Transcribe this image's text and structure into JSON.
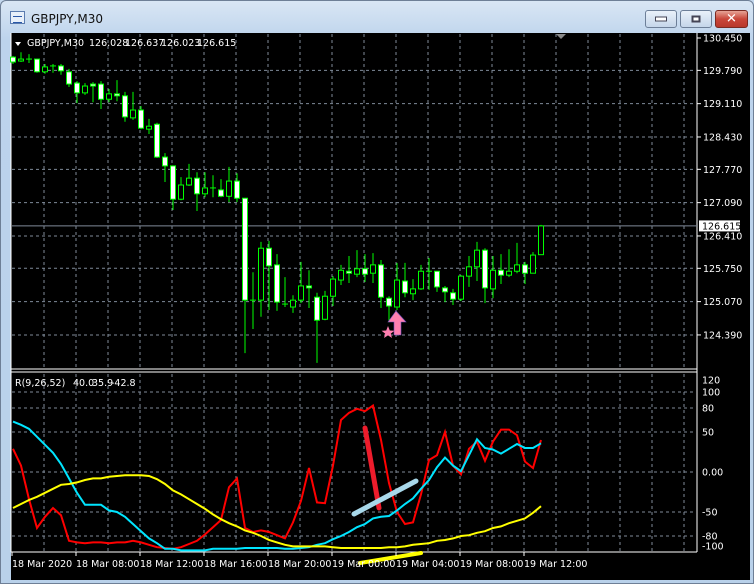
{
  "window": {
    "title": "GBPJPY,M30",
    "icon": "chart-window-icon",
    "buttons": [
      "minimize",
      "maximize",
      "close"
    ]
  },
  "colors": {
    "background": "#000000",
    "candle": "#00ff00",
    "bear_body": "#ffffff",
    "bull_body": "#000000",
    "grid": "#8090a0",
    "red_line": "#ff0000",
    "cyan_line": "#00e5ff",
    "yellow_line": "#ffff00",
    "arrow": "#ff7fb0"
  },
  "header": {
    "symbol": "GBPJPY,M30",
    "open": "126.028",
    "high": "126.637",
    "low": "126.023",
    "close": "126.615"
  },
  "price_axis": {
    "labels": [
      "130.450",
      "129.790",
      "129.110",
      "128.430",
      "127.770",
      "127.090",
      "126.410",
      "125.750",
      "125.070",
      "124.390"
    ],
    "current_price": "126.615"
  },
  "indicator": {
    "name": "R(9,26,52)",
    "values": [
      "40.0",
      "35.9",
      "-42.8"
    ],
    "levels": [
      "120",
      "100",
      "80",
      "50",
      "0.00",
      "-50",
      "-80",
      "-100"
    ]
  },
  "time_axis": {
    "labels": [
      "18 Mar 2020",
      "18 Mar 08:00",
      "18 Mar 12:00",
      "18 Mar 16:00",
      "18 Mar 20:00",
      "19 Mar 00:00",
      "19 Mar 04:00",
      "19 Mar 08:00",
      "19 Mar 12:00"
    ]
  },
  "chart_data": [
    {
      "type": "candlestick",
      "timeframe": "M30",
      "ylim": [
        123.72,
        130.55
      ],
      "grid": true,
      "ohlc": [
        [
          130.06,
          130.08,
          129.92,
          129.96
        ],
        [
          129.98,
          130.16,
          129.96,
          130.02
        ],
        [
          130.0,
          130.12,
          129.94,
          130.02
        ],
        [
          130.02,
          130.02,
          129.74,
          129.76
        ],
        [
          129.76,
          129.92,
          129.72,
          129.86
        ],
        [
          129.86,
          129.92,
          129.74,
          129.88
        ],
        [
          129.88,
          129.92,
          129.7,
          129.78
        ],
        [
          129.76,
          129.82,
          129.45,
          129.51
        ],
        [
          129.53,
          129.57,
          129.12,
          129.33
        ],
        [
          129.33,
          129.53,
          129.29,
          129.47
        ],
        [
          129.51,
          129.55,
          129.14,
          129.47
        ],
        [
          129.51,
          129.57,
          129.0,
          129.2
        ],
        [
          129.2,
          129.41,
          129.14,
          129.31
        ],
        [
          129.31,
          129.59,
          129.16,
          129.27
        ],
        [
          129.27,
          129.35,
          128.74,
          128.84
        ],
        [
          128.82,
          129.35,
          128.78,
          128.98
        ],
        [
          128.98,
          129.06,
          128.59,
          128.61
        ],
        [
          128.59,
          128.8,
          128.49,
          128.65
        ],
        [
          128.69,
          128.72,
          128.0,
          128.02
        ],
        [
          128.02,
          128.1,
          127.51,
          127.84
        ],
        [
          127.84,
          127.84,
          126.94,
          127.16
        ],
        [
          127.16,
          127.61,
          127.14,
          127.45
        ],
        [
          127.45,
          127.88,
          127.43,
          127.59
        ],
        [
          127.59,
          127.71,
          126.92,
          127.27
        ],
        [
          127.27,
          127.71,
          127.2,
          127.39
        ],
        [
          127.39,
          127.65,
          127.2,
          127.39
        ],
        [
          127.35,
          127.57,
          127.2,
          127.22
        ],
        [
          127.22,
          127.82,
          127.1,
          127.53
        ],
        [
          127.53,
          127.69,
          127.1,
          127.18
        ],
        [
          127.18,
          127.18,
          124.02,
          125.1
        ],
        [
          125.1,
          125.67,
          124.51,
          125.1
        ],
        [
          125.1,
          126.29,
          124.76,
          126.16
        ],
        [
          126.16,
          126.31,
          124.9,
          125.8
        ],
        [
          125.82,
          126.04,
          124.88,
          125.06
        ],
        [
          125.02,
          125.57,
          124.96,
          125.02
        ],
        [
          124.96,
          125.2,
          124.84,
          125.1
        ],
        [
          125.1,
          125.88,
          125.04,
          125.39
        ],
        [
          125.39,
          125.71,
          124.94,
          125.35
        ],
        [
          125.16,
          125.25,
          123.82,
          124.69
        ],
        [
          124.71,
          125.29,
          124.69,
          125.18
        ],
        [
          125.18,
          125.59,
          124.98,
          125.53
        ],
        [
          125.51,
          125.82,
          125.41,
          125.71
        ],
        [
          125.69,
          126.0,
          125.45,
          125.65
        ],
        [
          125.63,
          126.12,
          125.57,
          125.74
        ],
        [
          125.74,
          126.04,
          125.47,
          125.63
        ],
        [
          125.65,
          126.06,
          125.45,
          125.82
        ],
        [
          125.82,
          125.92,
          124.94,
          125.16
        ],
        [
          125.14,
          125.18,
          124.65,
          124.98
        ],
        [
          124.96,
          125.86,
          124.9,
          125.51
        ],
        [
          125.49,
          125.86,
          125.16,
          125.25
        ],
        [
          125.23,
          125.53,
          125.1,
          125.33
        ],
        [
          125.33,
          125.82,
          125.31,
          125.69
        ],
        [
          125.69,
          125.96,
          125.31,
          125.69
        ],
        [
          125.69,
          125.69,
          125.27,
          125.37
        ],
        [
          125.35,
          125.39,
          125.06,
          125.27
        ],
        [
          125.25,
          125.33,
          125.0,
          125.12
        ],
        [
          125.12,
          125.61,
          125.08,
          125.59
        ],
        [
          125.59,
          126.0,
          125.37,
          125.78
        ],
        [
          125.78,
          126.29,
          125.49,
          126.12
        ],
        [
          126.12,
          126.16,
          125.04,
          125.35
        ],
        [
          125.33,
          126.0,
          125.14,
          125.71
        ],
        [
          125.71,
          126.04,
          125.43,
          125.61
        ],
        [
          125.61,
          126.14,
          125.57,
          125.69
        ],
        [
          125.69,
          126.27,
          125.65,
          125.82
        ],
        [
          125.82,
          125.88,
          125.43,
          125.65
        ],
        [
          125.65,
          126.08,
          125.65,
          126.02
        ],
        [
          126.028,
          126.637,
          126.023,
          126.615
        ]
      ]
    },
    {
      "type": "line",
      "ylim": [
        -100,
        120
      ],
      "grid": true,
      "series": [
        {
          "color": "#ff0000",
          "values": [
            29,
            8,
            -34,
            -70,
            -56,
            -45,
            -54,
            -86,
            -88,
            -89,
            -88,
            -88,
            -89,
            -88,
            -88,
            -86,
            -88,
            -91,
            -94,
            -95,
            -96,
            -94,
            -90,
            -86,
            -78,
            -69,
            -60,
            -19,
            -8,
            -70,
            -75,
            -73,
            -75,
            -79,
            -83,
            -63,
            -36,
            5,
            -38,
            -39,
            8,
            65,
            74,
            79,
            76,
            83,
            40,
            -14,
            -50,
            -65,
            -63,
            -28,
            15,
            21,
            50,
            8,
            -3,
            29,
            38,
            14,
            38,
            53,
            53,
            46,
            13,
            5,
            40.0
          ]
        },
        {
          "color": "#00e5ff",
          "values": [
            63,
            59,
            54,
            44,
            34,
            24,
            10,
            -8,
            -26,
            -41,
            -41,
            -41,
            -48,
            -50,
            -56,
            -65,
            -74,
            -83,
            -89,
            -96,
            -96,
            -98,
            -98,
            -98,
            -98,
            -96,
            -96,
            -96,
            -96,
            -95,
            -95,
            -95,
            -95,
            -95,
            -96,
            -96,
            -95,
            -94,
            -91,
            -89,
            -84,
            -80,
            -75,
            -69,
            -65,
            -58,
            -56,
            -55,
            -48,
            -40,
            -33,
            -21,
            -10,
            6,
            18,
            8,
            1,
            21,
            41,
            30,
            28,
            23,
            29,
            35,
            30,
            30,
            35.9
          ]
        },
        {
          "color": "#ffff00",
          "values": [
            -45,
            -40,
            -35,
            -31,
            -26,
            -21,
            -16,
            -15,
            -13,
            -10,
            -8,
            -8,
            -6,
            -5,
            -4,
            -4,
            -4,
            -5,
            -9,
            -15,
            -23,
            -28,
            -34,
            -40,
            -46,
            -53,
            -59,
            -64,
            -68,
            -73,
            -76,
            -80,
            -85,
            -88,
            -91,
            -93,
            -93,
            -93,
            -93,
            -93,
            -94,
            -95,
            -95,
            -95,
            -95,
            -95,
            -95,
            -94,
            -94,
            -93,
            -91,
            -90,
            -89,
            -86,
            -85,
            -83,
            -80,
            -79,
            -76,
            -74,
            -70,
            -68,
            -64,
            -61,
            -58,
            -51,
            -42.8
          ]
        }
      ]
    }
  ]
}
